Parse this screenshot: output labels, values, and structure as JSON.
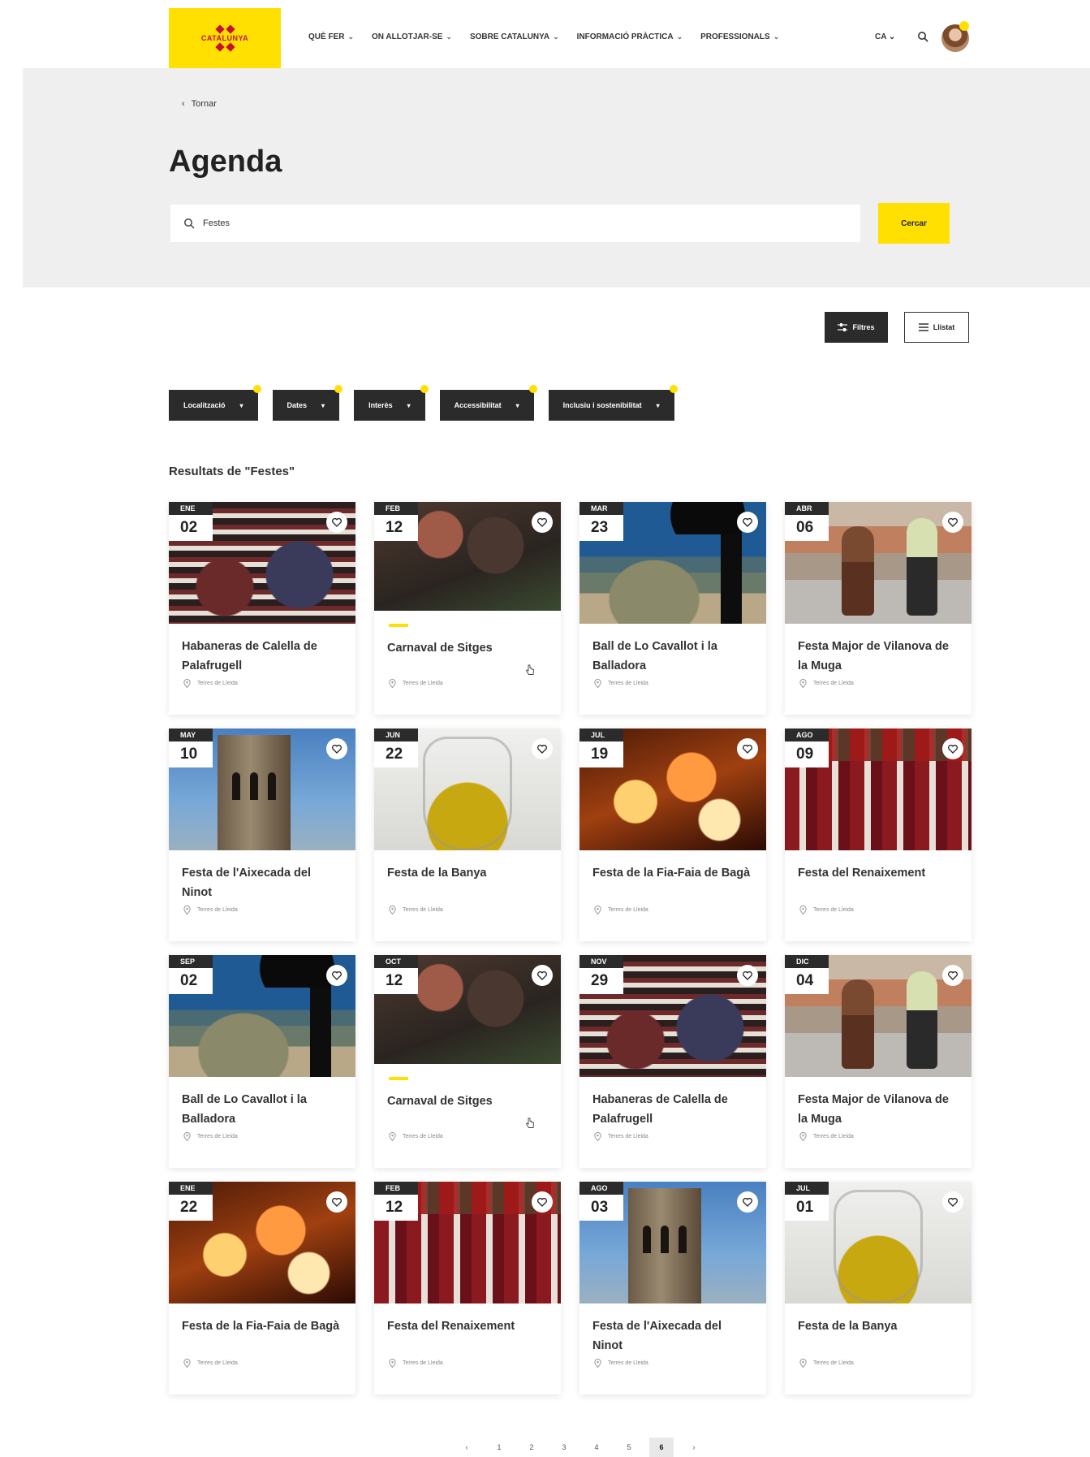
{
  "header": {
    "logo_text": "CATALUNYA",
    "nav": [
      {
        "label": "QUÈ FER"
      },
      {
        "label": "ON ALLOTJAR-SE"
      },
      {
        "label": "SOBRE CATALUNYA"
      },
      {
        "label": "INFORMACIÓ PRÀCTICA"
      },
      {
        "label": "PROFESSIONALS"
      }
    ],
    "lang": "CA",
    "accent_color": "#ffe000"
  },
  "hero": {
    "breadcrumb": "Tornar",
    "title": "Agenda",
    "search_value": "Festes",
    "search_button": "Cercar"
  },
  "view": {
    "filter_label": "Filtres",
    "list_label": "Llistat"
  },
  "filters": [
    {
      "label": "Localització"
    },
    {
      "label": "Dates"
    },
    {
      "label": "Interès"
    },
    {
      "label": "Accessibilitat"
    },
    {
      "label": "Inclusiu i sostenibilitat"
    }
  ],
  "results_label": "Resultats de \"Festes\"",
  "cards": [
    {
      "month": "ENE",
      "day": "02",
      "title": "Habaneras de Calella de Palafrugell",
      "location": "Terres de Lleida",
      "image": "habaneras"
    },
    {
      "month": "FEB",
      "day": "12",
      "title": "Carnaval de Sitges",
      "location": "Terres de Lleida",
      "image": "carnaval",
      "highlight": true
    },
    {
      "month": "MAR",
      "day": "23",
      "title": "Ball de Lo Cavallot i la Balladora",
      "location": "Terres de Lleida",
      "image": "ball"
    },
    {
      "month": "ABR",
      "day": "06",
      "title": "Festa Major de Vilanova de la Muga",
      "location": "Terres de Lleida",
      "image": "vilanova"
    },
    {
      "month": "MAY",
      "day": "10",
      "title": "Festa de l'Aixecada del Ninot",
      "location": "Terres de Lleida",
      "image": "aixecada"
    },
    {
      "month": "JUN",
      "day": "22",
      "title": "Festa de la Banya",
      "location": "Terres de Lleida",
      "image": "banya"
    },
    {
      "month": "JUL",
      "day": "19",
      "title": "Festa de la Fia-Faia de Bagà",
      "location": "Terres de Lleida",
      "image": "fiafaia"
    },
    {
      "month": "AGO",
      "day": "09",
      "title": "Festa del Renaixement",
      "location": "Terres de Lleida",
      "image": "renaixement"
    },
    {
      "month": "SEP",
      "day": "02",
      "title": "Ball de Lo Cavallot i la Balladora",
      "location": "Terres de Lleida",
      "image": "ball"
    },
    {
      "month": "OCT",
      "day": "12",
      "title": "Carnaval de Sitges",
      "location": "Terres de Lleida",
      "image": "carnaval",
      "highlight": true
    },
    {
      "month": "NOV",
      "day": "29",
      "title": "Habaneras de Calella de Palafrugell",
      "location": "Terres de Lleida",
      "image": "habaneras"
    },
    {
      "month": "DIC",
      "day": "04",
      "title": "Festa Major de Vilanova de la Muga",
      "location": "Terres de Lleida",
      "image": "vilanova"
    },
    {
      "month": "ENE",
      "day": "22",
      "title": "Festa de la Fia-Faia de Bagà",
      "location": "Terres de Lleida",
      "image": "fiafaia"
    },
    {
      "month": "FEB",
      "day": "12",
      "title": "Festa del Renaixement",
      "location": "Terres de Lleida",
      "image": "renaixement"
    },
    {
      "month": "AGO",
      "day": "03",
      "title": "Festa de l'Aixecada del Ninot",
      "location": "Terres de Lleida",
      "image": "aixecada"
    },
    {
      "month": "JUL",
      "day": "01",
      "title": "Festa de la Banya",
      "location": "Terres de Lleida",
      "image": "banya"
    }
  ],
  "pagination": {
    "pages": [
      "‹",
      "1",
      "2",
      "3",
      "4",
      "5",
      "6",
      "›"
    ],
    "active": "6"
  }
}
